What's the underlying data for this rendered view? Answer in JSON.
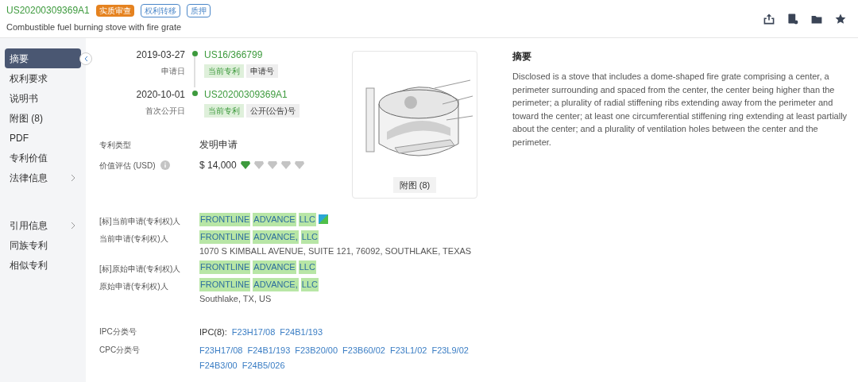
{
  "header": {
    "number": "US20200309369A1",
    "badges": [
      {
        "label": "实质审查",
        "kind": "filled"
      },
      {
        "label": "权利转移",
        "kind": "outline"
      },
      {
        "label": "质押",
        "kind": "outline"
      }
    ],
    "title": "Combustible fuel burning stove with fire grate",
    "actions": [
      {
        "kind": "export"
      },
      {
        "kind": "report"
      },
      {
        "kind": "folder"
      },
      {
        "kind": "star"
      }
    ]
  },
  "sidebar": {
    "items": [
      {
        "label": "摘要",
        "selected": true,
        "expandable": false
      },
      {
        "label": "权利要求",
        "selected": false,
        "expandable": false
      },
      {
        "label": "说明书",
        "selected": false,
        "expandable": false
      },
      {
        "label": "附图 (8)",
        "selected": false,
        "expandable": false
      },
      {
        "label": "PDF",
        "selected": false,
        "expandable": false
      },
      {
        "label": "专利价值",
        "selected": false,
        "expandable": false
      },
      {
        "label": "法律信息",
        "selected": false,
        "expandable": true
      }
    ],
    "items_2": [
      {
        "label": "引用信息",
        "selected": false,
        "expandable": true
      },
      {
        "label": "同族专利",
        "selected": false,
        "expandable": false
      },
      {
        "label": "相似专利",
        "selected": false,
        "expandable": false
      }
    ]
  },
  "timeline": [
    {
      "date": "2019-03-27",
      "date_label": "申请日",
      "number": "US16/366799",
      "tags": [
        "当前专利",
        "申请号"
      ]
    },
    {
      "date": "2020-10-01",
      "date_label": "首次公开日",
      "number": "US20200309369A1",
      "tags": [
        "当前专利",
        "公开(公告)号"
      ]
    }
  ],
  "patent_type": {
    "label": "专利类型",
    "value": "发明申请"
  },
  "valuation": {
    "label": "价值评估 (USD)",
    "value": "$ 14,000",
    "stars": 1
  },
  "figure": {
    "kind": "picture",
    "button": "附图 (8)"
  },
  "abstract": {
    "title": "摘要",
    "text": "Disclosed is a stove that includes a dome-shaped fire grate comprising a center, a perimeter surrounding and spaced from the center, the center being higher than the perimeter; a plurality of radial stiffening ribs extending away from the perimeter and toward the center; at least one circumferential stiffening ring extending at least partially about the center; and a plurality of ventilation holes between the center and the perimeter."
  },
  "applicants": [
    {
      "label": "[标]当前申请(专利权)人",
      "name": "FRONTLINE ADVANCE LLC",
      "logo": true
    },
    {
      "label": "当前申请(专利权)人",
      "name": "FRONTLINE ADVANCE, LLC",
      "logo": false,
      "address": "1070 S KIMBALL AVENUE, SUITE 121, 76092, SOUTHLAKE, TEXAS"
    },
    {
      "label": "[标]原始申请(专利权)人",
      "name": "FRONTLINE ADVANCE LLC",
      "logo": false
    },
    {
      "label": "原始申请(专利权)人",
      "name": "FRONTLINE ADVANCE, LLC",
      "logo": false,
      "address": "Southlake, TX, US"
    }
  ],
  "classification": [
    {
      "label": "IPC分类号",
      "prefix": "IPC(8):",
      "codes": [
        "F23H17/08",
        "F24B1/193"
      ]
    },
    {
      "label": "CPC分类号",
      "codes": [
        "F23H17/08",
        "F24B1/193",
        "F23B20/00",
        "F23B60/02",
        "F23L1/02",
        "F23L9/02",
        "F24B3/00",
        "F24B5/026"
      ]
    }
  ]
}
